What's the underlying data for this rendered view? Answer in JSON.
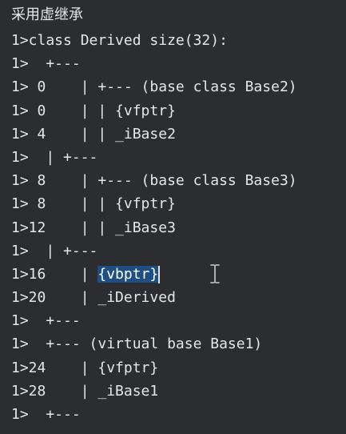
{
  "title": "采用虚继承",
  "lines": [
    {
      "text": "1>class Derived size(32):"
    },
    {
      "text": "1>  +---"
    },
    {
      "text": "1> 0    | +--- (base class Base2)"
    },
    {
      "text": "1> 0    | | {vfptr}"
    },
    {
      "text": "1> 4    | | _iBase2"
    },
    {
      "text": "1>  | +---"
    },
    {
      "text": "1> 8    | +--- (base class Base3)"
    },
    {
      "text": "1> 8    | | {vfptr}"
    },
    {
      "text": "1>12    | | _iBase3"
    },
    {
      "text": "1>  | +---"
    },
    {
      "prefix": "1>16    | ",
      "selected": "{vbptr}"
    },
    {
      "text": "1>20    | _iDerived"
    },
    {
      "text": "1>  +---"
    },
    {
      "text": "1>  +--- (virtual base Base1)"
    },
    {
      "text": "1>24    | {vfptr}"
    },
    {
      "text": "1>28    | _iBase1"
    },
    {
      "text": "1>  +---"
    }
  ],
  "colors": {
    "background": "#2b2d30",
    "text": "#e6e6e6",
    "selection": "#1f4f82"
  },
  "icons": {
    "cursor": "ibeam-cursor-icon"
  }
}
